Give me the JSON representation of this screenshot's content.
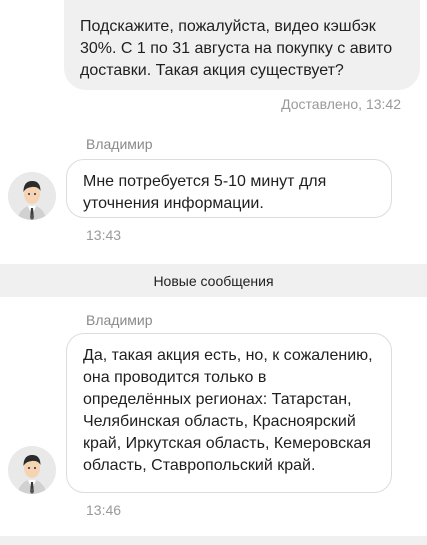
{
  "messages": [
    {
      "direction": "outgoing",
      "text": "Подскажите, пожалуйста, видео кэшбэк 30%. С 1 по 31 августа на покупку с авито доставки. Такая акция существует?",
      "status": "Доставлено, 13:42"
    },
    {
      "direction": "incoming",
      "sender": "Владимир",
      "avatar_icon": "operator-avatar-icon",
      "text": "Мне потребуется 5-10 минут для уточнения информации.",
      "time": "13:43"
    },
    {
      "direction": "incoming",
      "sender": "Владимир",
      "avatar_icon": "operator-avatar-icon",
      "text": "Да, такая акция есть, но, к сожалению, она проводится только в определённых регионах: Татарстан, Челябинская область, Красноярский край, Иркутская область, Кемеровская область, Ставропольский край.",
      "time": "13:46"
    }
  ],
  "divider": {
    "label": "Новые сообщения"
  },
  "colors": {
    "outgoing_bubble": "#f0f0f0",
    "incoming_bubble_border": "#dcdcdc",
    "meta_text": "#9a9a9a",
    "divider_bg": "#f0f0f0"
  }
}
